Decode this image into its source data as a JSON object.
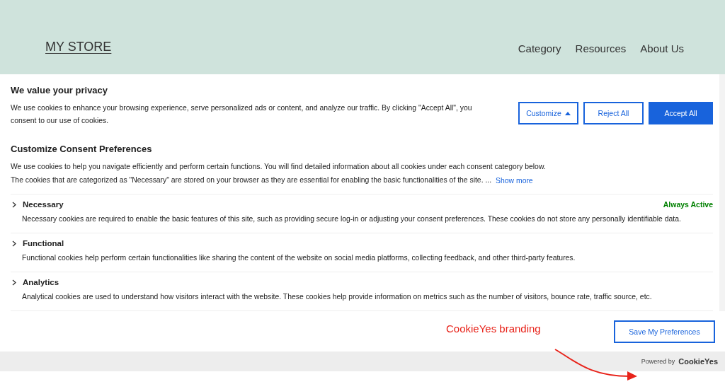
{
  "header": {
    "logo": "MY STORE",
    "nav": [
      "Category",
      "Resources",
      "About Us"
    ]
  },
  "banner": {
    "title": "We value your privacy",
    "text": "We use cookies to enhance your browsing experience, serve personalized ads or content, and analyze our traffic. By clicking \"Accept All\", you consent to our use of cookies.",
    "buttons": [
      {
        "label": "Customize",
        "kind": "outline-caret"
      },
      {
        "label": "Reject All",
        "kind": "outline"
      },
      {
        "label": "Accept All",
        "kind": "primary"
      }
    ]
  },
  "preferences": {
    "title": "Customize Consent Preferences",
    "text_1": "We use cookies to help you navigate efficiently and perform certain functions. You will find detailed information about all cookies under each consent category below.",
    "text_2": "The cookies that are categorized as \"Necessary\" are stored on your browser as they are essential for enabling the basic functionalities of the site. ...",
    "show_more": "Show more",
    "categories": [
      {
        "name": "Necessary",
        "status": "Always Active",
        "description": "Necessary cookies are required to enable the basic features of this site, such as providing secure log-in or adjusting your consent preferences. These cookies do not store any personally identifiable data."
      },
      {
        "name": "Functional",
        "description": "Functional cookies help perform certain functionalities like sharing the content of the website on social media platforms, collecting feedback, and other third-party features."
      },
      {
        "name": "Analytics",
        "description": "Analytical cookies are used to understand how visitors interact with the website. These cookies help provide information on metrics such as the number of visitors, bounce rate, traffic source, etc."
      }
    ],
    "save_button": "Save My Preferences"
  },
  "annotation": "CookieYes branding",
  "powered_by": {
    "prefix": "Powered by",
    "brand": "CookieYes"
  }
}
